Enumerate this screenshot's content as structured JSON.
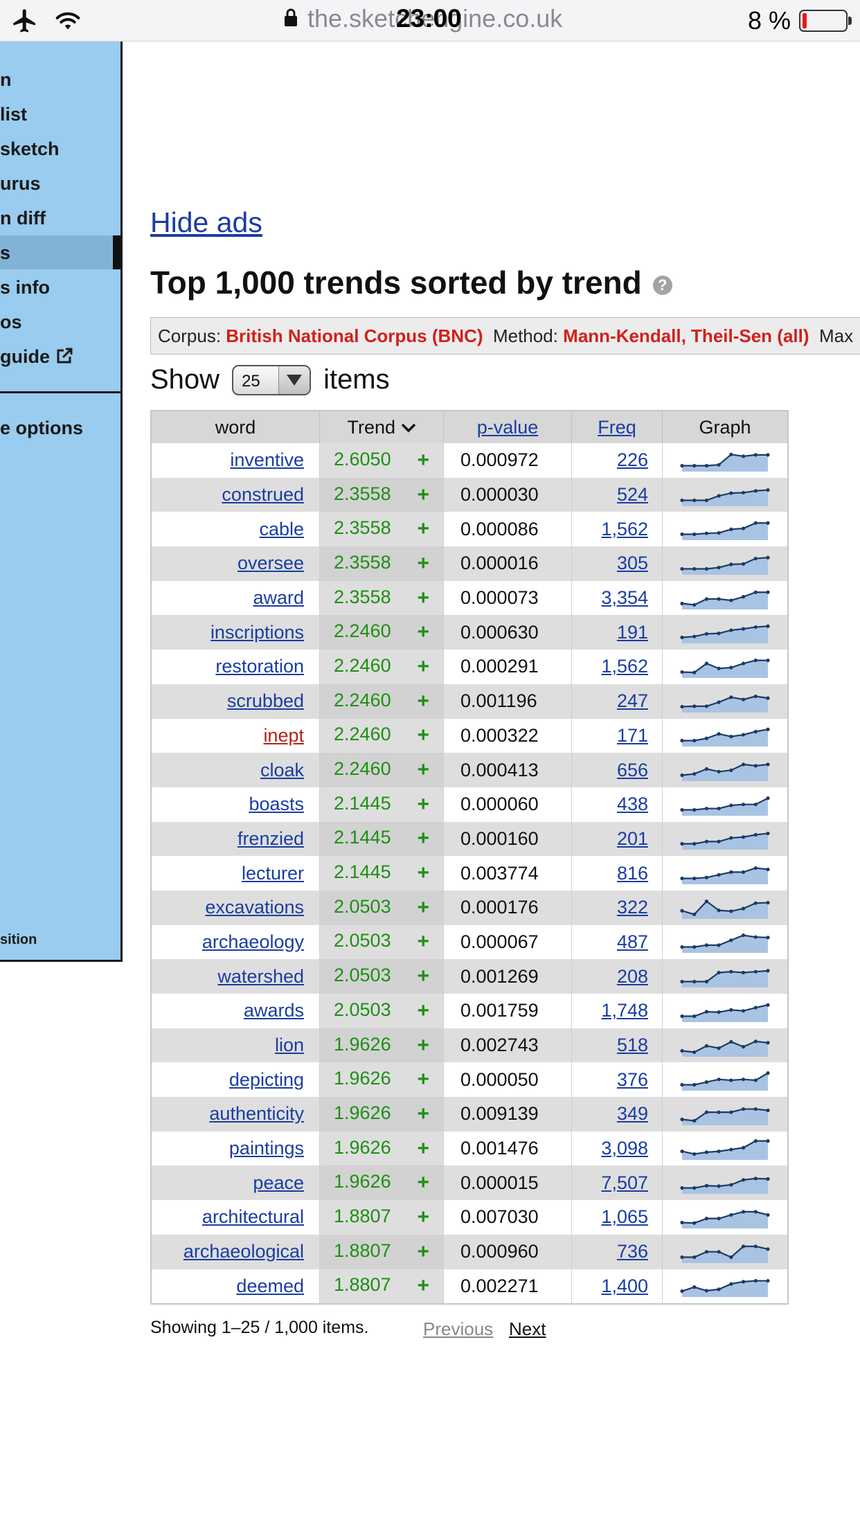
{
  "statusbar": {
    "url": "the.sketchengine.co.uk",
    "time": "23:00",
    "battery": "8 %",
    "icons": [
      "airplane-icon",
      "wifi-icon",
      "lock-icon",
      "battery-icon"
    ]
  },
  "sidebar": {
    "items": [
      "n",
      "list",
      "sketch",
      "urus",
      "n diff",
      "s",
      "s info",
      "os",
      "guide",
      "e options"
    ],
    "bottom_text": "sition",
    "active_item": "s"
  },
  "ads_link": "Hide ads",
  "title": "Top 1,000 trends sorted by trend",
  "corpus_bar": {
    "corpus_label": "Corpus:",
    "corpus_value": "British National Corpus (BNC)",
    "method_label": "Method:",
    "method_value": "Mann-Kendall, Theil-Sen (all)",
    "max_label": "Max"
  },
  "show": {
    "prefix": "Show",
    "selected": "25",
    "suffix": "items"
  },
  "table": {
    "headers": {
      "word": "word",
      "trend": "Trend",
      "pvalue": "p-value",
      "freq": "Freq",
      "graph": "Graph"
    },
    "rows": [
      {
        "word": "inventive",
        "trend": "2.6050",
        "sign": "+",
        "p": "0.000972",
        "freq": "226",
        "spark": [
          1,
          1,
          1,
          1.2,
          3.5,
          3.1,
          3.4,
          3.4
        ]
      },
      {
        "word": "construed",
        "trend": "2.3558",
        "sign": "+",
        "p": "0.000030",
        "freq": "524",
        "spark": [
          1,
          1,
          1,
          2,
          2.6,
          2.7,
          3.1,
          3.3
        ]
      },
      {
        "word": "cable",
        "trend": "2.3558",
        "sign": "+",
        "p": "0.000086",
        "freq": "1,562",
        "spark": [
          1,
          1,
          1.2,
          1.3,
          2.1,
          2.3,
          3.5,
          3.5
        ]
      },
      {
        "word": "oversee",
        "trend": "2.3558",
        "sign": "+",
        "p": "0.000016",
        "freq": "305",
        "spark": [
          1,
          1,
          1,
          1.3,
          2,
          2.1,
          3.3,
          3.5
        ]
      },
      {
        "word": "award",
        "trend": "2.3558",
        "sign": "+",
        "p": "0.000073",
        "freq": "3,354",
        "spark": [
          1,
          0.7,
          2,
          2,
          1.7,
          2.5,
          3.5,
          3.5
        ]
      },
      {
        "word": "inscriptions",
        "trend": "2.2460",
        "sign": "+",
        "p": "0.000630",
        "freq": "191",
        "spark": [
          1,
          1.2,
          1.8,
          1.9,
          2.6,
          2.9,
          3.3,
          3.5
        ]
      },
      {
        "word": "restoration",
        "trend": "2.2460",
        "sign": "+",
        "p": "0.000291",
        "freq": "1,562",
        "spark": [
          1,
          0.9,
          2.9,
          1.8,
          2,
          2.9,
          3.6,
          3.6
        ]
      },
      {
        "word": "scrubbed",
        "trend": "2.2460",
        "sign": "+",
        "p": "0.001196",
        "freq": "247",
        "spark": [
          1,
          1.1,
          1.1,
          2,
          3.1,
          2.6,
          3.3,
          2.9
        ]
      },
      {
        "word": "inept",
        "trend": "2.2460",
        "sign": "+",
        "p": "0.000322",
        "freq": "171",
        "spark": [
          1,
          1,
          1.5,
          2.5,
          1.9,
          2.3,
          3,
          3.5
        ],
        "visited": true
      },
      {
        "word": "cloak",
        "trend": "2.2460",
        "sign": "+",
        "p": "0.000413",
        "freq": "656",
        "spark": [
          1,
          1.3,
          2.4,
          1.8,
          2.1,
          3.4,
          3.1,
          3.4
        ]
      },
      {
        "word": "boasts",
        "trend": "2.1445",
        "sign": "+",
        "p": "0.000060",
        "freq": "438",
        "spark": [
          1,
          1,
          1.3,
          1.3,
          2,
          2.2,
          2.2,
          3.6
        ]
      },
      {
        "word": "frenzied",
        "trend": "2.1445",
        "sign": "+",
        "p": "0.000160",
        "freq": "201",
        "spark": [
          1,
          1,
          1.5,
          1.5,
          2.3,
          2.5,
          3,
          3.3
        ]
      },
      {
        "word": "lecturer",
        "trend": "2.1445",
        "sign": "+",
        "p": "0.003774",
        "freq": "816",
        "spark": [
          1,
          1,
          1.2,
          1.8,
          2.4,
          2.4,
          3.3,
          3
        ]
      },
      {
        "word": "excavations",
        "trend": "2.0503",
        "sign": "+",
        "p": "0.000176",
        "freq": "322",
        "spark": [
          1.5,
          0.7,
          3.6,
          1.6,
          1.4,
          2,
          3.2,
          3.3
        ]
      },
      {
        "word": "archaeology",
        "trend": "2.0503",
        "sign": "+",
        "p": "0.000067",
        "freq": "487",
        "spark": [
          1,
          1,
          1.4,
          1.4,
          2.5,
          3.6,
          3.2,
          3.1
        ]
      },
      {
        "word": "watershed",
        "trend": "2.0503",
        "sign": "+",
        "p": "0.001269",
        "freq": "208",
        "spark": [
          1,
          1,
          1,
          3,
          3.2,
          3,
          3.2,
          3.4
        ]
      },
      {
        "word": "awards",
        "trend": "2.0503",
        "sign": "+",
        "p": "0.001759",
        "freq": "1,748",
        "spark": [
          1,
          1,
          2,
          1.9,
          2.4,
          2.2,
          2.9,
          3.5
        ]
      },
      {
        "word": "lion",
        "trend": "1.9626",
        "sign": "+",
        "p": "0.002743",
        "freq": "518",
        "spark": [
          1,
          0.7,
          2.1,
          1.6,
          3,
          1.9,
          3.1,
          2.8
        ]
      },
      {
        "word": "depicting",
        "trend": "1.9626",
        "sign": "+",
        "p": "0.000050",
        "freq": "376",
        "spark": [
          1,
          1,
          1.6,
          2.2,
          2,
          2.2,
          2,
          3.6
        ]
      },
      {
        "word": "authenticity",
        "trend": "1.9626",
        "sign": "+",
        "p": "0.009139",
        "freq": "349",
        "spark": [
          1,
          0.7,
          2.6,
          2.6,
          2.6,
          3.3,
          3.3,
          3
        ]
      },
      {
        "word": "paintings",
        "trend": "1.9626",
        "sign": "+",
        "p": "0.001476",
        "freq": "3,098",
        "spark": [
          1.6,
          1,
          1.4,
          1.6,
          2,
          2.4,
          3.9,
          3.9
        ]
      },
      {
        "word": "peace",
        "trend": "1.9626",
        "sign": "+",
        "p": "0.000015",
        "freq": "7,507",
        "spark": [
          1,
          1,
          1.5,
          1.4,
          1.7,
          2.8,
          3.1,
          3
        ]
      },
      {
        "word": "architectural",
        "trend": "1.8807",
        "sign": "+",
        "p": "0.007030",
        "freq": "1,065",
        "spark": [
          1,
          0.9,
          1.9,
          1.9,
          2.7,
          3.4,
          3.4,
          2.7
        ]
      },
      {
        "word": "archaeological",
        "trend": "1.8807",
        "sign": "+",
        "p": "0.000960",
        "freq": "736",
        "spark": [
          1,
          1,
          2.2,
          2.2,
          1,
          3.4,
          3.4,
          2.8
        ]
      },
      {
        "word": "deemed",
        "trend": "1.8807",
        "sign": "+",
        "p": "0.002271",
        "freq": "1,400",
        "spark": [
          1,
          1.9,
          1.1,
          1.4,
          2.6,
          3.1,
          3.3,
          3.3
        ]
      }
    ]
  },
  "footer": {
    "showing": "Showing 1–25 / 1,000 items.",
    "previous": "Previous",
    "next": "Next"
  },
  "colors": {
    "sidebar_bg": "#99ccee",
    "link": "#1a3da0",
    "visited_link": "#b3251a",
    "trend_green": "#1e8f14",
    "meta_red": "#d0211c",
    "spark_fill": "#a9c3e3",
    "spark_line": "#1c3a64"
  }
}
